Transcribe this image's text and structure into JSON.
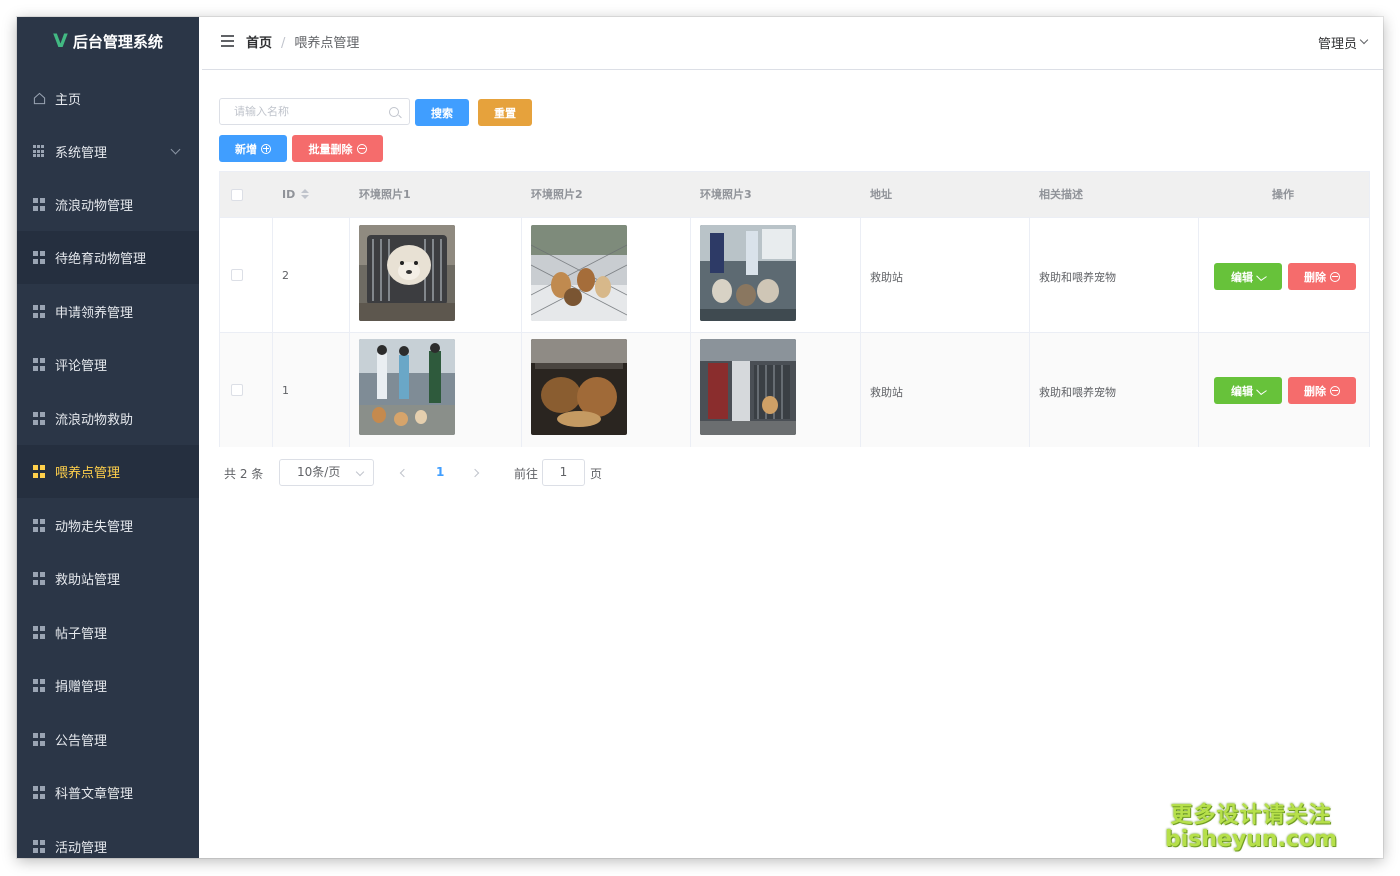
{
  "app": {
    "title": "后台管理系统",
    "logo_glyph": "V",
    "accent": "#42b983"
  },
  "sidebar": {
    "bg": "#2b3647",
    "active_color": "#ffd04b",
    "items": [
      {
        "label": "主页",
        "icon": "home-icon"
      },
      {
        "label": "系统管理",
        "icon": "grid-icon"
      },
      {
        "label": "流浪动物管理",
        "icon": "grid-icon"
      },
      {
        "label": "待绝育动物管理",
        "icon": "grid-icon"
      },
      {
        "label": "申请领养管理",
        "icon": "grid-icon"
      },
      {
        "label": "评论管理",
        "icon": "grid-icon"
      },
      {
        "label": "流浪动物救助",
        "icon": "grid-icon"
      },
      {
        "label": "喂养点管理",
        "icon": "grid-icon",
        "active": true
      },
      {
        "label": "动物走失管理",
        "icon": "grid-icon"
      },
      {
        "label": "救助站管理",
        "icon": "grid-icon"
      },
      {
        "label": "帖子管理",
        "icon": "grid-icon"
      },
      {
        "label": "捐赠管理",
        "icon": "grid-icon"
      },
      {
        "label": "公告管理",
        "icon": "grid-icon"
      },
      {
        "label": "科普文章管理",
        "icon": "grid-icon"
      },
      {
        "label": "活动管理",
        "icon": "grid-icon"
      }
    ]
  },
  "header": {
    "breadcrumb_home": "首页",
    "breadcrumb_sep": "/",
    "breadcrumb_current": "喂养点管理",
    "user": "管理员"
  },
  "toolbar": {
    "search_placeholder": "请输入名称",
    "search_label": "搜索",
    "reset_label": "重置",
    "add_label": "新增",
    "batch_delete_label": "批量删除",
    "colors": {
      "primary": "#409eff",
      "warning": "#e6a23c",
      "danger": "#f56c6c",
      "success": "#67c23a"
    }
  },
  "table": {
    "columns": [
      "ID",
      "环境照片1",
      "环境照片2",
      "环境照片3",
      "地址",
      "相关描述",
      "操作"
    ],
    "rows": [
      {
        "id": "2",
        "address": "救助站",
        "description": "救助和喂养宠物"
      },
      {
        "id": "1",
        "address": "救助站",
        "description": "救助和喂养宠物"
      }
    ],
    "edit_label": "编辑",
    "delete_label": "删除"
  },
  "pagination": {
    "total_text": "共 2 条",
    "page_size": "10条/页",
    "current_page": "1",
    "goto_prefix": "前往",
    "goto_value": "1",
    "goto_suffix": "页"
  },
  "watermark": {
    "line1": "更多设计请关注",
    "line2": "bisheyun.com"
  }
}
